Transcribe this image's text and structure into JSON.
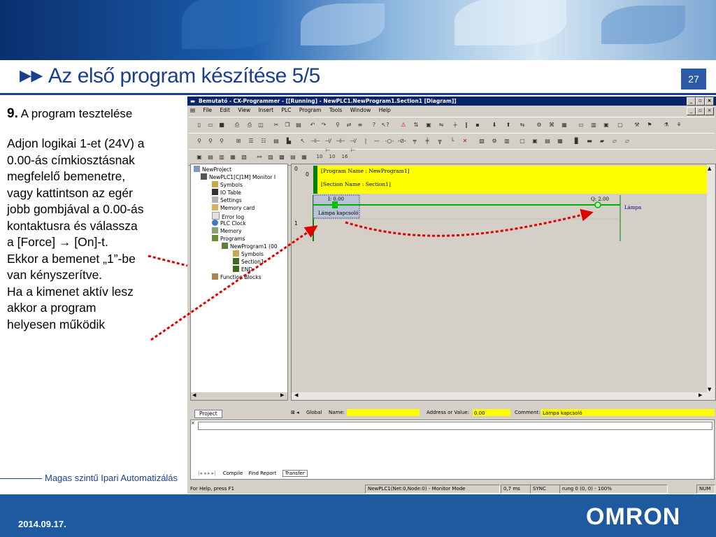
{
  "slide": {
    "title": "Az első program készítése 5/5",
    "page_number": "27",
    "step_number": "9.",
    "step_title": "A program tesztelése",
    "instructions": [
      "Adjon logikai 1-et (24V) a",
      "0.00-ás címkiosztásnak",
      "megfelelő bemenetre,",
      "vagy kattintson az egér",
      "jobb gombjával a 0.00-ás",
      "kontaktusra és válassza",
      "a [Force] → [On]-t.",
      "Ekkor a bemenet „1”-be",
      "van kényszerítve.",
      "Ha a kimenet aktív lesz",
      "akkor a program",
      "helyesen működik"
    ],
    "footer_tagline": "Magas szintű Ipari Automatizálás",
    "footer_date": "2014.09.17.",
    "logo": "OMRON",
    "accent_color": "#1b3f8f",
    "arrow_color": "#e00000"
  },
  "app": {
    "window_title": "Bemutató - CX-Programmer - [[Running] - NewPLC1.NewProgram1.Section1 [Diagram]]",
    "menu": [
      "File",
      "Edit",
      "View",
      "Insert",
      "PLC",
      "Program",
      "Tools",
      "Window",
      "Help"
    ],
    "tree": {
      "root": "NewProject",
      "plc": "NewPLC1[CJ1M] Monitor I",
      "items": [
        "Symbols",
        "IO Table",
        "Settings",
        "Memory card",
        "Error log",
        "PLC Clock",
        "Memory",
        "Programs"
      ],
      "program": "NewProgram1 (00",
      "program_items": [
        "Symbols",
        "Section1",
        "END"
      ],
      "function_blocks": "Function Blocks",
      "tab": "Project"
    },
    "diagram": {
      "rung0": "0",
      "rung0_step": "0",
      "rung1": "1",
      "program_name": "[Program Name : NewProgram1]",
      "section_name": "[Section Name : Section1]",
      "contact_address": "I: 0.00",
      "contact_comment": "Lámpa kapcsoló",
      "coil_address": "Q: 2.00",
      "coil_comment": "Lámpa"
    },
    "infobar": {
      "global": "Global",
      "name_label": "Name:",
      "address_label": "Address or Value:",
      "address_value": "0.00",
      "comment_label": "Comment:",
      "comment_value": "Lámpa kapcsoló"
    },
    "output_tabs": [
      "Compile",
      "Find Report",
      "Transfer"
    ],
    "status": {
      "help": "For Help, press F1",
      "plc": "NewPLC1(Net:0,Node:0) - Monitor Mode",
      "cycle": "0,7 ms",
      "sync": "SYNC",
      "rung": "rung 0 (0, 0)  - 100%",
      "num": "NUM"
    }
  }
}
